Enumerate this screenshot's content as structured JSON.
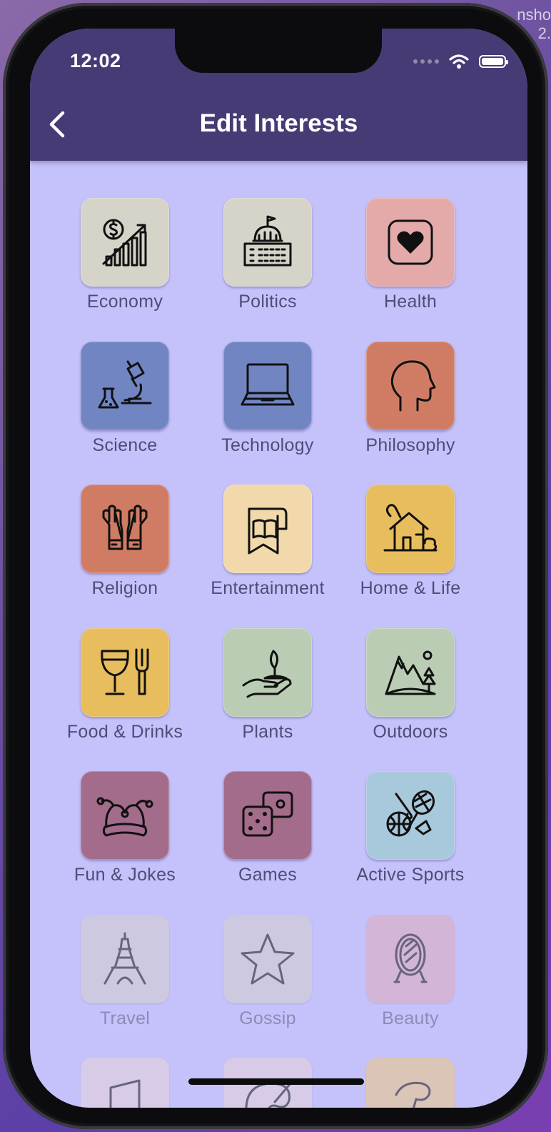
{
  "corner_text": [
    "nsho",
    "2."
  ],
  "status_bar": {
    "time": "12:02"
  },
  "header": {
    "title": "Edit Interests"
  },
  "colors": {
    "header_bg": "#473b76",
    "screen_bg": "#c5c2fb",
    "label": "#4f4c78"
  },
  "interests": [
    {
      "label": "Economy",
      "icon": "economy-icon",
      "color": "#d6d3c9",
      "faded": false
    },
    {
      "label": "Politics",
      "icon": "capitol-icon",
      "color": "#d6d3c9",
      "faded": false
    },
    {
      "label": "Health",
      "icon": "heart-icon",
      "color": "#e4aaaa",
      "faded": false
    },
    {
      "label": "Science",
      "icon": "microscope-icon",
      "color": "#7185c2",
      "faded": false
    },
    {
      "label": "Technology",
      "icon": "laptop-icon",
      "color": "#7185c2",
      "faded": false
    },
    {
      "label": "Philosophy",
      "icon": "head-icon",
      "color": "#d07c64",
      "faded": false
    },
    {
      "label": "Religion",
      "icon": "praying-hands-icon",
      "color": "#d07c64",
      "faded": false
    },
    {
      "label": "Entertainment",
      "icon": "book-icon",
      "color": "#f2d9ac",
      "faded": false
    },
    {
      "label": "Home & Life",
      "icon": "house-icon",
      "color": "#e7bd5d",
      "faded": false
    },
    {
      "label": "Food & Drinks",
      "icon": "wine-fork-icon",
      "color": "#e7bd5d",
      "faded": false
    },
    {
      "label": "Plants",
      "icon": "sprout-hand-icon",
      "color": "#bacdb4",
      "faded": false
    },
    {
      "label": "Outdoors",
      "icon": "mountain-icon",
      "color": "#bacdb4",
      "faded": false
    },
    {
      "label": "Fun & Jokes",
      "icon": "jester-hat-icon",
      "color": "#a26c8a",
      "faded": false
    },
    {
      "label": "Games",
      "icon": "dice-icon",
      "color": "#a26c8a",
      "faded": false
    },
    {
      "label": "Active Sports",
      "icon": "sports-icon",
      "color": "#a8c8dc",
      "faded": false
    },
    {
      "label": "Travel",
      "icon": "eiffel-tower-icon",
      "color": "#cdcadf",
      "faded": true
    },
    {
      "label": "Gossip",
      "icon": "star-icon",
      "color": "#cdcadf",
      "faded": true
    },
    {
      "label": "Beauty",
      "icon": "mirror-icon",
      "color": "#d4b4d4",
      "faded": true
    },
    {
      "label": "",
      "icon": "music-icon",
      "color": "#d9cce6",
      "faded": true
    },
    {
      "label": "",
      "icon": "palette-icon",
      "color": "#d9cce6",
      "faded": true
    },
    {
      "label": "",
      "icon": "animal-icon",
      "color": "#ddc6b0",
      "faded": true
    }
  ]
}
